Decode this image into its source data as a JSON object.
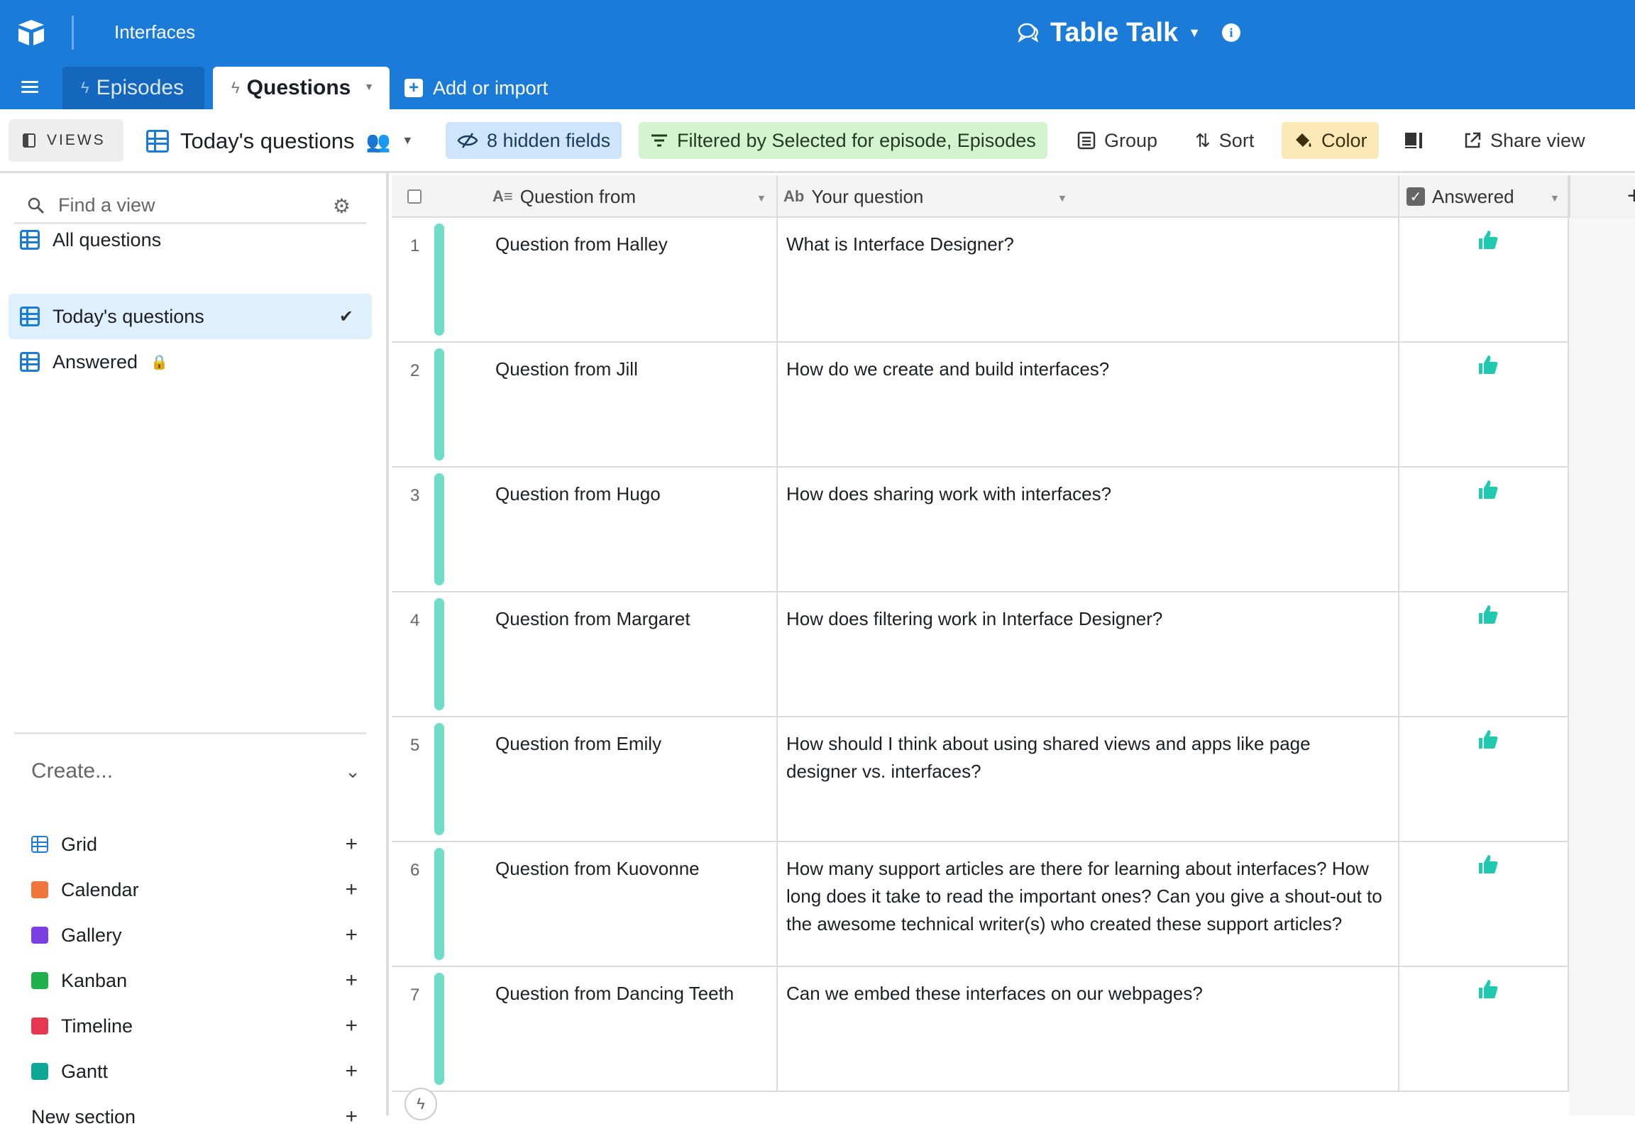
{
  "header": {
    "breadcrumb": "Interfaces",
    "base_name": "Table Talk",
    "info_icon": "i"
  },
  "tabs": [
    {
      "label": "Episodes",
      "active": false
    },
    {
      "label": "Questions",
      "active": true
    }
  ],
  "add_import_label": "Add or import",
  "viewbar": {
    "views_label": "VIEWS",
    "current_view": "Today's questions",
    "hidden_fields": "8 hidden fields",
    "filter": "Filtered by Selected for episode, Episodes",
    "group": "Group",
    "sort": "Sort",
    "color": "Color",
    "share": "Share view"
  },
  "sidebar": {
    "search_placeholder": "Find a view",
    "views": [
      {
        "label": "All questions",
        "active": false,
        "locked": false
      },
      {
        "label": "Today's questions",
        "active": true,
        "locked": false
      },
      {
        "label": "Answered",
        "active": false,
        "locked": true
      }
    ],
    "create_label": "Create...",
    "create_items": [
      {
        "label": "Grid",
        "color": "#1b7bd8"
      },
      {
        "label": "Calendar",
        "color": "#f0743e"
      },
      {
        "label": "Gallery",
        "color": "#7b3fe4"
      },
      {
        "label": "Kanban",
        "color": "#20b04b"
      },
      {
        "label": "Timeline",
        "color": "#e5374f"
      },
      {
        "label": "Gantt",
        "color": "#0fa896"
      }
    ],
    "new_section": "New section"
  },
  "grid": {
    "columns": [
      "Question from",
      "Your question",
      "Answered"
    ],
    "rows": [
      {
        "num": "1",
        "from": "Question from Halley",
        "question": "What is Interface Designer?"
      },
      {
        "num": "2",
        "from": "Question from Jill",
        "question": "How do we create and build interfaces?"
      },
      {
        "num": "3",
        "from": "Question from Hugo",
        "question": "How does sharing work with interfaces?"
      },
      {
        "num": "4",
        "from": "Question from Margaret",
        "question": "How does filtering work in Interface Designer?"
      },
      {
        "num": "5",
        "from": "Question from Emily",
        "question": "How should I think about using shared views and apps like page designer vs. interfaces?"
      },
      {
        "num": "6",
        "from": "Question from Kuovonne",
        "question": "How many support articles are there for learning about interfaces? How long does it take to read the important ones? Can you give a shout-out to the awesome technical writer(s) who created these support articles?"
      },
      {
        "num": "7",
        "from": "Question from Dancing Teeth",
        "question": "Can we embed these interfaces on our webpages?"
      }
    ],
    "row_color": "#6fddc6",
    "thumb_color": "#20c9b0"
  },
  "colors": {
    "brand": "#1b7bd8",
    "active_view_bg": "#dfeffb"
  }
}
